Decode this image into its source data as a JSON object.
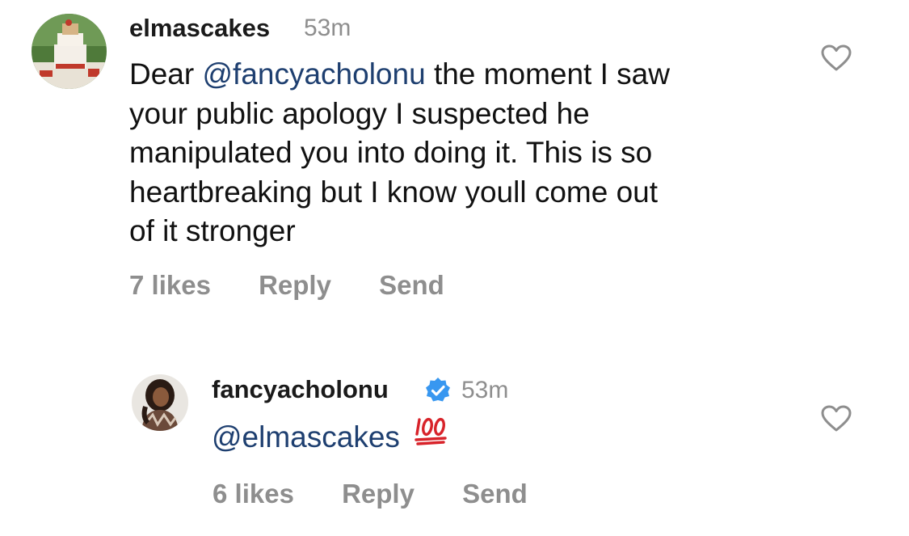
{
  "comments": [
    {
      "username": "elmascakes",
      "time": "53m",
      "text_mention": "@fancyacholonu",
      "text_line1_before": "Dear ",
      "text_line1_after": " the moment I saw",
      "text_rest": [
        "your public apology I suspected he",
        "manipulated you into doing it. This is so",
        "heartbreaking but I know youll come out",
        "of it stronger"
      ],
      "likes": "7 likes",
      "reply_label": "Reply",
      "send_label": "Send",
      "like_icon": "heart-outline-icon"
    },
    {
      "username": "fancyacholonu",
      "verified": true,
      "time": "53m",
      "text_mention": "@elmascakes",
      "emoji": "100-emoji",
      "likes": "6 likes",
      "reply_label": "Reply",
      "send_label": "Send",
      "like_icon": "heart-outline-icon"
    }
  ],
  "colors": {
    "mention": "#1e3f70",
    "muted": "#8e8e8e",
    "verified": "#3897f0",
    "emoji_red": "#d8232a"
  }
}
